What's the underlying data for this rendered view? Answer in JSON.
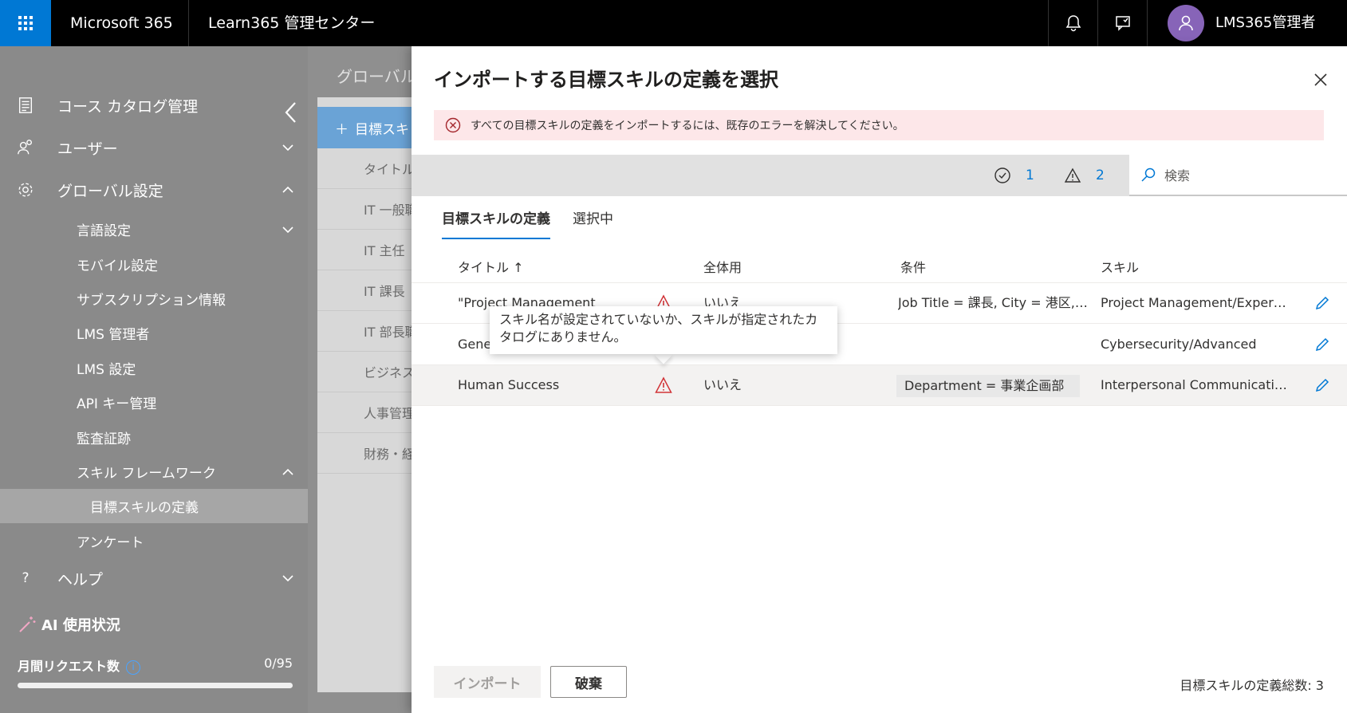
{
  "topbar": {
    "brand": "Microsoft 365",
    "app_title": "Learn365 管理センター",
    "user_name": "LMS365管理者",
    "icons": [
      "waffle-icon",
      "bell-icon",
      "feedback-icon",
      "person-icon"
    ],
    "accent": "#0078d4",
    "avatar_color": "#8764b8"
  },
  "sidebar": {
    "items": [
      {
        "label": "コース カタログ管理",
        "icon": "catalog-icon"
      },
      {
        "label": "ユーザー",
        "icon": "users-icon"
      },
      {
        "label": "グローバル設定",
        "icon": "gear-icon"
      }
    ],
    "sub_items": [
      {
        "label": "言語設定"
      },
      {
        "label": "モバイル設定"
      },
      {
        "label": "サブスクリプション情報"
      },
      {
        "label": "LMS 管理者"
      },
      {
        "label": "LMS 設定"
      },
      {
        "label": "API キー管理"
      },
      {
        "label": "監査証跡"
      },
      {
        "label": "スキル フレームワーク"
      },
      {
        "label": "目標スキルの定義"
      },
      {
        "label": "アンケート"
      }
    ],
    "help": {
      "label": "ヘルプ",
      "icon": "?"
    },
    "ai": {
      "title": "AI 使用状況",
      "requests_label": "月間リクエスト数",
      "requests_value": "0/95",
      "usage_fraction": 0
    }
  },
  "background_page": {
    "title": "グローバル",
    "add_button": "目標スキ",
    "column": "タイトル",
    "rows": [
      "IT 一般職",
      "IT 主任",
      "IT 課長",
      "IT 部長職",
      "ビジネス",
      "人事管理",
      "財務・経"
    ]
  },
  "panel": {
    "title": "インポートする目標スキルの定義を選択",
    "error_message": "すべての目標スキルの定義をインポートするには、既存のエラーを解決してください。",
    "valid_count": "1",
    "warning_count": "2",
    "search_placeholder": "検索",
    "tabs": [
      {
        "label": "目標スキルの定義"
      },
      {
        "label": "選択中"
      }
    ],
    "columns": {
      "title": "タイトル ↑",
      "global": "全体用",
      "conditions": "条件",
      "skills": "スキル"
    },
    "rows": [
      {
        "title": "\"Project Management",
        "global": "いいえ",
        "conditions": "Job Title = 課長, City = 港区, ...",
        "skills": "Project Management/Expert\",..."
      },
      {
        "title": "Gene",
        "global": "",
        "conditions": "",
        "skills": "Cybersecurity/Advanced"
      },
      {
        "title": "Human Success",
        "global": "いいえ",
        "conditions": "Department = 事業企画部",
        "skills": "Interpersonal Communication..."
      }
    ],
    "tooltip": "スキル名が設定されていないか、スキルが指定されたカタログにありません。",
    "import_button": "インポート",
    "discard_button": "破棄",
    "total": "目標スキルの定義総数: 3",
    "warning_color": "#d13438"
  }
}
